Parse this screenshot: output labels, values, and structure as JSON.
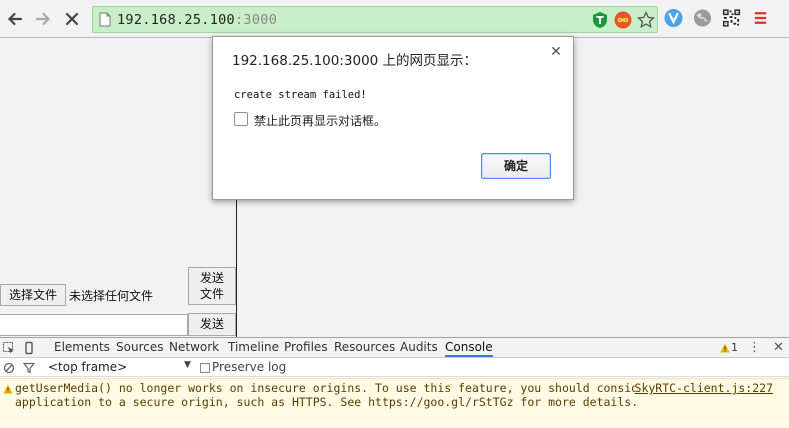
{
  "browser": {
    "url_host": "192.168.25.100",
    "url_port": ":3000"
  },
  "page": {
    "choose_file_button": "选择文件",
    "no_file_label": "未选择任何文件",
    "send_file_button_line1": "发送",
    "send_file_button_line2": "文件",
    "message_value": "",
    "send_button": "发送"
  },
  "dialog": {
    "title": "192.168.25.100:3000 上的网页显示：",
    "message": "create stream failed!",
    "checkbox_label": "禁止此页再显示对话框。",
    "ok_button": "确定"
  },
  "devtools": {
    "tabs": [
      "Elements",
      "Sources",
      "Network",
      "Timeline",
      "Profiles",
      "Resources",
      "Audits",
      "Console"
    ],
    "active_tab": "Console",
    "warning_count": "1",
    "frame_select": "<top frame>",
    "preserve_log_label": "Preserve log",
    "console_warning": "getUserMedia() no longer works on insecure origins. To use this feature, you should consider switching your application to a secure origin, such as HTTPS. See https://goo.gl/rStTGz for more details.",
    "console_source": "SkyRTC-client.js:227"
  },
  "colors": {
    "omnibox_bg": "#c9efc9",
    "active_tab_underline": "#3879d9",
    "warning_bg": "#fffbe5",
    "warning_text": "#5c3c00",
    "ok_button_border": "#4d90fe"
  },
  "icons": [
    "back-icon",
    "forward-icon",
    "stop-icon",
    "page-icon",
    "shield-extension-icon",
    "infinity-extension-icon",
    "star-icon",
    "vivaldi-extension-icon",
    "globe-extension-icon",
    "qr-code-icon",
    "menu-icon",
    "inspect-element-icon",
    "device-mode-icon",
    "warning-icon",
    "more-icon",
    "close-icon",
    "clear-console-icon",
    "filter-icon"
  ]
}
